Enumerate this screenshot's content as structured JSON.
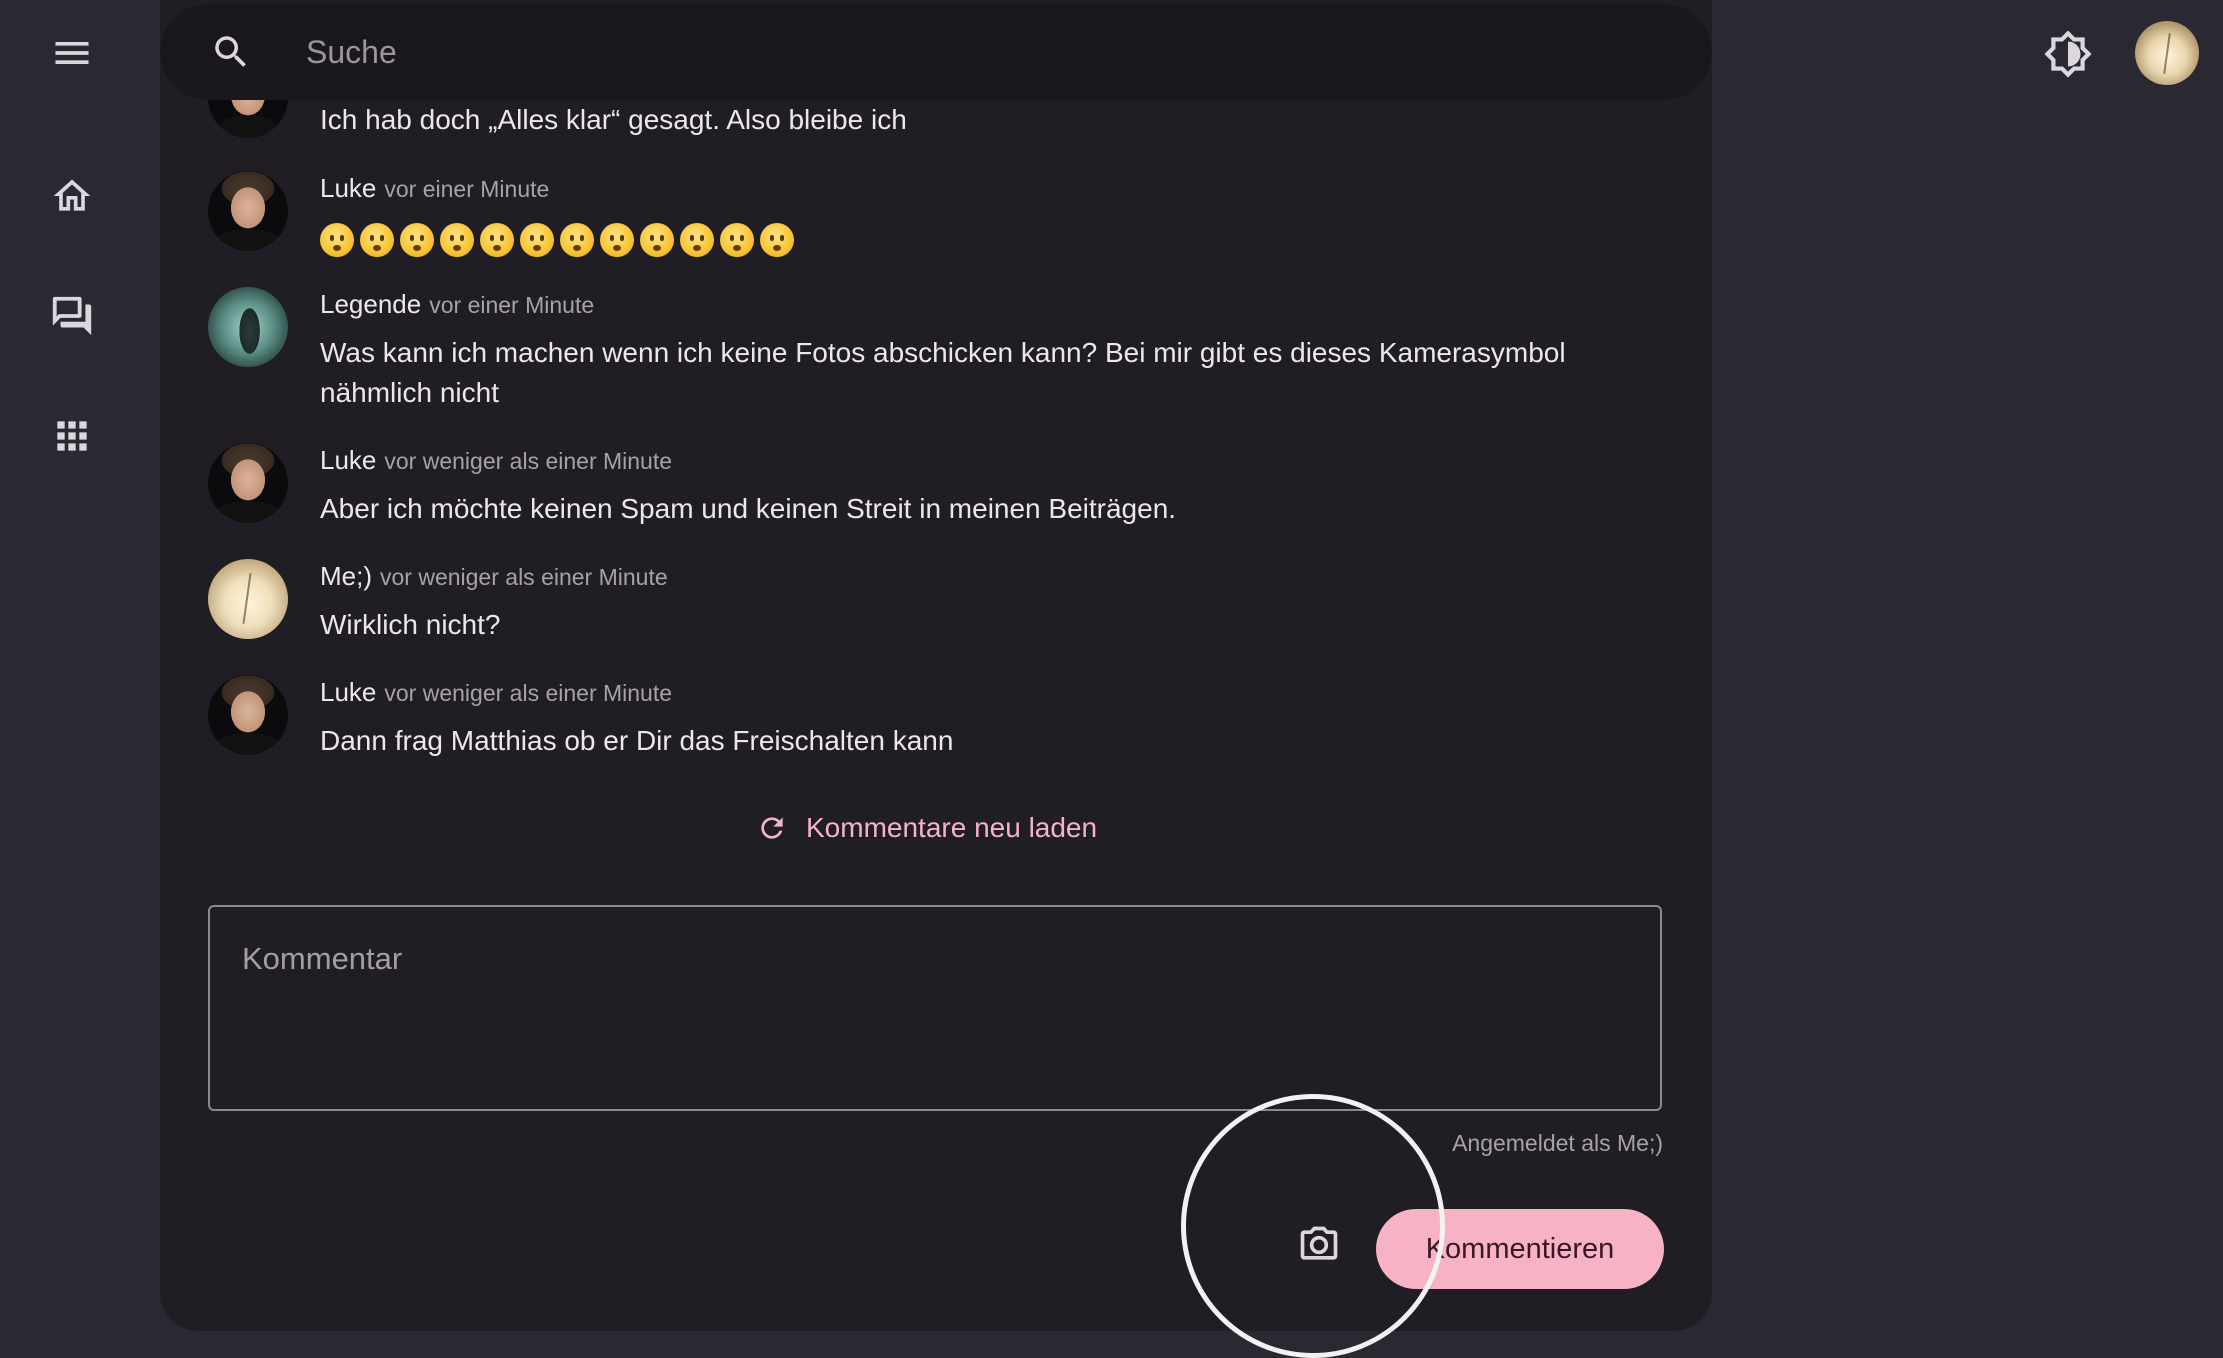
{
  "search": {
    "placeholder": "Suche"
  },
  "comments": [
    {
      "author": "",
      "time": "",
      "text": "Ich hab doch „Alles klar“ gesagt. Also bleibe ich",
      "avatar": "luke"
    },
    {
      "author": "Luke",
      "time": "vor einer Minute",
      "text": "",
      "emoji": [
        "😗",
        "😙",
        "😚",
        "😗",
        "😙",
        "😚",
        "😗",
        "😙",
        "😚",
        "😗",
        "😙",
        "😚"
      ],
      "avatar": "luke"
    },
    {
      "author": "Legende",
      "time": "vor einer Minute",
      "text": "Was kann ich machen wenn ich keine Fotos abschicken kann? Bei mir gibt es dieses Kamerasymbol nähmlich nicht",
      "avatar": "legende"
    },
    {
      "author": "Luke",
      "time": "vor weniger als einer Minute",
      "text": "Aber ich möchte keinen Spam und keinen Streit in meinen Beiträgen.",
      "avatar": "luke"
    },
    {
      "author": "Me;)",
      "time": "vor weniger als einer Minute",
      "text": "Wirklich nicht?",
      "avatar": "me"
    },
    {
      "author": "Luke",
      "time": "vor weniger als einer Minute",
      "text": "Dann frag Matthias ob er Dir das Freischalten kann",
      "avatar": "luke"
    }
  ],
  "reload_label": "Kommentare neu laden",
  "comment_input": {
    "placeholder": "Kommentar"
  },
  "signed_in": "Angemeldet als Me;)",
  "submit_label": "Kommentieren",
  "icons": {
    "menu": "menu-icon",
    "home": "home-icon",
    "forum": "forum-icon",
    "apps": "apps-icon",
    "search": "search-icon",
    "theme": "brightness-icon",
    "refresh": "refresh-icon",
    "camera": "camera-icon"
  },
  "colors": {
    "accent": "#f7b2c6",
    "accent_text": "#f4b3c7",
    "background": "#2a2831",
    "card": "#201e24"
  }
}
